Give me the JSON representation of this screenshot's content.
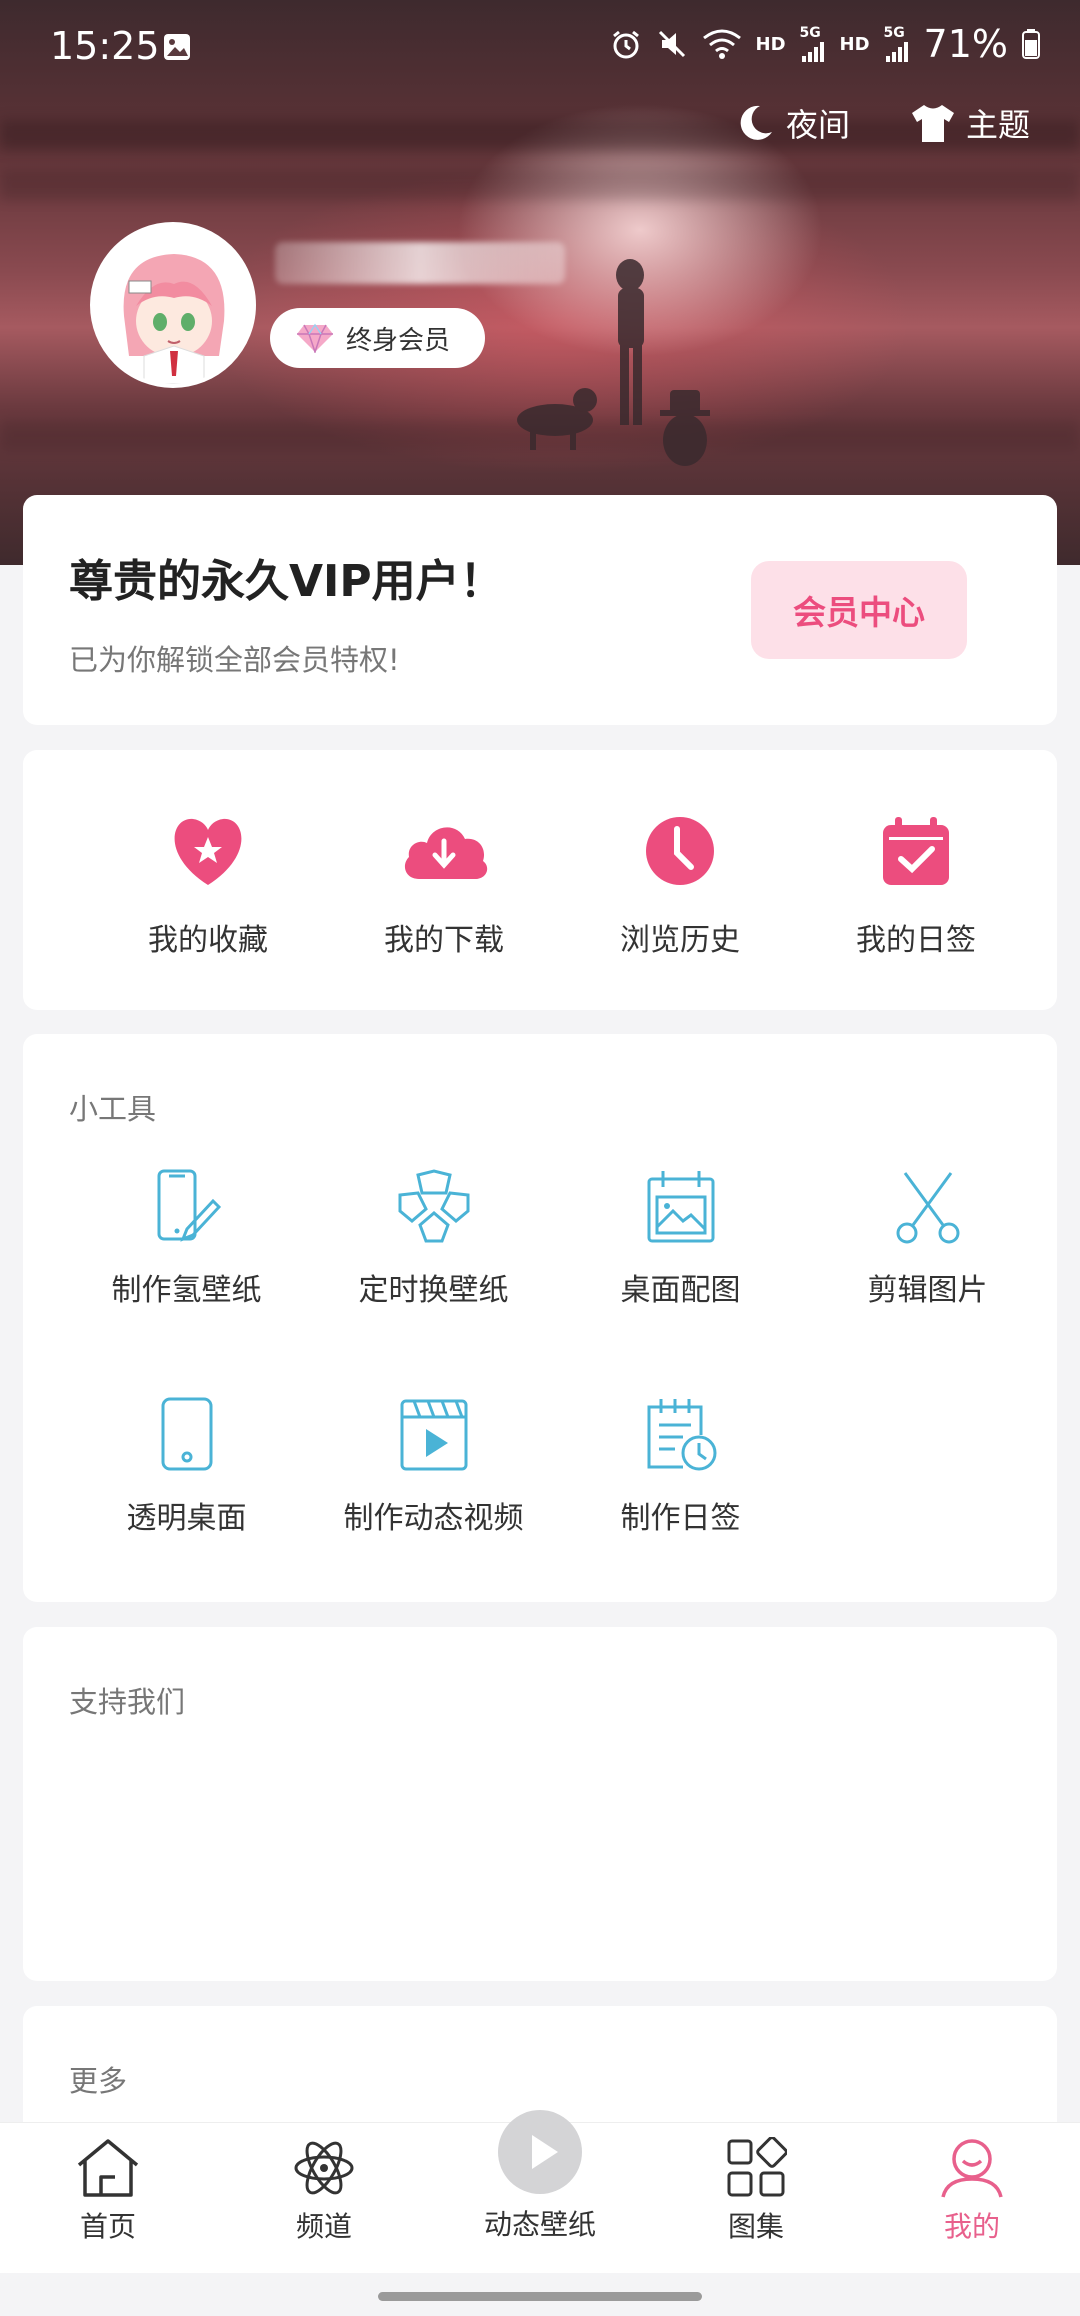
{
  "status_bar": {
    "time": "15:25",
    "indicators": [
      "alarm-icon",
      "mute-icon",
      "wifi-icon",
      "HD",
      "5G",
      "HD",
      "5G"
    ],
    "battery": "71%"
  },
  "header": {
    "night_label": "夜间",
    "theme_label": "主题",
    "membership_badge": "终身会员"
  },
  "vip_card": {
    "title": "尊贵的永久VIP用户！",
    "subtitle": "已为你解锁全部会员特权!",
    "button": "会员中心"
  },
  "quick_actions": [
    {
      "label": "我的收藏",
      "icon": "heart-star-icon"
    },
    {
      "label": "我的下载",
      "icon": "cloud-download-icon"
    },
    {
      "label": "浏览历史",
      "icon": "clock-icon"
    },
    {
      "label": "我的日签",
      "icon": "calendar-check-icon"
    }
  ],
  "tools": {
    "title": "小工具",
    "items": [
      {
        "label": "制作氢壁纸",
        "icon": "phone-edit-icon"
      },
      {
        "label": "定时换壁纸",
        "icon": "pentagon-shuffle-icon"
      },
      {
        "label": "桌面配图",
        "icon": "calendar-image-icon"
      },
      {
        "label": "剪辑图片",
        "icon": "scissors-icon"
      },
      {
        "label": "透明桌面",
        "icon": "phone-icon"
      },
      {
        "label": "制作动态视频",
        "icon": "video-clapper-icon"
      },
      {
        "label": "制作日签",
        "icon": "notepad-clock-icon"
      }
    ]
  },
  "support": {
    "title": "支持我们"
  },
  "more": {
    "title": "更多"
  },
  "bottom_nav": [
    {
      "label": "首页",
      "icon": "home-icon"
    },
    {
      "label": "频道",
      "icon": "atom-icon"
    },
    {
      "label": "动态壁纸",
      "icon": "play-icon"
    },
    {
      "label": "图集",
      "icon": "grid-icon"
    },
    {
      "label": "我的",
      "icon": "user-icon",
      "active": true
    }
  ],
  "colors": {
    "accent": "#ec4d7e",
    "tool_icon": "#4ab3d6",
    "nav_active": "#e8608c"
  }
}
